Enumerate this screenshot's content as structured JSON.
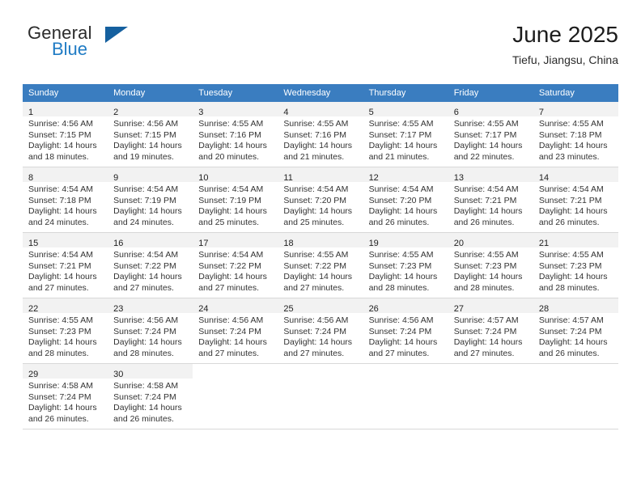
{
  "brand": {
    "line1": "General",
    "line2": "Blue",
    "triangle_icon": "triangle-logo-icon",
    "accent_color": "#1f7bc4",
    "dark_accent_color": "#15609f"
  },
  "header": {
    "title": "June 2025",
    "subtitle": "Tiefu, Jiangsu, China"
  },
  "calendar": {
    "header_bg": "#3a7dc0",
    "daynum_bg": "#f2f2f2",
    "weekdays": [
      "Sunday",
      "Monday",
      "Tuesday",
      "Wednesday",
      "Thursday",
      "Friday",
      "Saturday"
    ],
    "weeks": [
      [
        {
          "day": "1",
          "sunrise": "Sunrise: 4:56 AM",
          "sunset": "Sunset: 7:15 PM",
          "daylight1": "Daylight: 14 hours",
          "daylight2": "and 18 minutes."
        },
        {
          "day": "2",
          "sunrise": "Sunrise: 4:56 AM",
          "sunset": "Sunset: 7:15 PM",
          "daylight1": "Daylight: 14 hours",
          "daylight2": "and 19 minutes."
        },
        {
          "day": "3",
          "sunrise": "Sunrise: 4:55 AM",
          "sunset": "Sunset: 7:16 PM",
          "daylight1": "Daylight: 14 hours",
          "daylight2": "and 20 minutes."
        },
        {
          "day": "4",
          "sunrise": "Sunrise: 4:55 AM",
          "sunset": "Sunset: 7:16 PM",
          "daylight1": "Daylight: 14 hours",
          "daylight2": "and 21 minutes."
        },
        {
          "day": "5",
          "sunrise": "Sunrise: 4:55 AM",
          "sunset": "Sunset: 7:17 PM",
          "daylight1": "Daylight: 14 hours",
          "daylight2": "and 21 minutes."
        },
        {
          "day": "6",
          "sunrise": "Sunrise: 4:55 AM",
          "sunset": "Sunset: 7:17 PM",
          "daylight1": "Daylight: 14 hours",
          "daylight2": "and 22 minutes."
        },
        {
          "day": "7",
          "sunrise": "Sunrise: 4:55 AM",
          "sunset": "Sunset: 7:18 PM",
          "daylight1": "Daylight: 14 hours",
          "daylight2": "and 23 minutes."
        }
      ],
      [
        {
          "day": "8",
          "sunrise": "Sunrise: 4:54 AM",
          "sunset": "Sunset: 7:18 PM",
          "daylight1": "Daylight: 14 hours",
          "daylight2": "and 24 minutes."
        },
        {
          "day": "9",
          "sunrise": "Sunrise: 4:54 AM",
          "sunset": "Sunset: 7:19 PM",
          "daylight1": "Daylight: 14 hours",
          "daylight2": "and 24 minutes."
        },
        {
          "day": "10",
          "sunrise": "Sunrise: 4:54 AM",
          "sunset": "Sunset: 7:19 PM",
          "daylight1": "Daylight: 14 hours",
          "daylight2": "and 25 minutes."
        },
        {
          "day": "11",
          "sunrise": "Sunrise: 4:54 AM",
          "sunset": "Sunset: 7:20 PM",
          "daylight1": "Daylight: 14 hours",
          "daylight2": "and 25 minutes."
        },
        {
          "day": "12",
          "sunrise": "Sunrise: 4:54 AM",
          "sunset": "Sunset: 7:20 PM",
          "daylight1": "Daylight: 14 hours",
          "daylight2": "and 26 minutes."
        },
        {
          "day": "13",
          "sunrise": "Sunrise: 4:54 AM",
          "sunset": "Sunset: 7:21 PM",
          "daylight1": "Daylight: 14 hours",
          "daylight2": "and 26 minutes."
        },
        {
          "day": "14",
          "sunrise": "Sunrise: 4:54 AM",
          "sunset": "Sunset: 7:21 PM",
          "daylight1": "Daylight: 14 hours",
          "daylight2": "and 26 minutes."
        }
      ],
      [
        {
          "day": "15",
          "sunrise": "Sunrise: 4:54 AM",
          "sunset": "Sunset: 7:21 PM",
          "daylight1": "Daylight: 14 hours",
          "daylight2": "and 27 minutes."
        },
        {
          "day": "16",
          "sunrise": "Sunrise: 4:54 AM",
          "sunset": "Sunset: 7:22 PM",
          "daylight1": "Daylight: 14 hours",
          "daylight2": "and 27 minutes."
        },
        {
          "day": "17",
          "sunrise": "Sunrise: 4:54 AM",
          "sunset": "Sunset: 7:22 PM",
          "daylight1": "Daylight: 14 hours",
          "daylight2": "and 27 minutes."
        },
        {
          "day": "18",
          "sunrise": "Sunrise: 4:55 AM",
          "sunset": "Sunset: 7:22 PM",
          "daylight1": "Daylight: 14 hours",
          "daylight2": "and 27 minutes."
        },
        {
          "day": "19",
          "sunrise": "Sunrise: 4:55 AM",
          "sunset": "Sunset: 7:23 PM",
          "daylight1": "Daylight: 14 hours",
          "daylight2": "and 28 minutes."
        },
        {
          "day": "20",
          "sunrise": "Sunrise: 4:55 AM",
          "sunset": "Sunset: 7:23 PM",
          "daylight1": "Daylight: 14 hours",
          "daylight2": "and 28 minutes."
        },
        {
          "day": "21",
          "sunrise": "Sunrise: 4:55 AM",
          "sunset": "Sunset: 7:23 PM",
          "daylight1": "Daylight: 14 hours",
          "daylight2": "and 28 minutes."
        }
      ],
      [
        {
          "day": "22",
          "sunrise": "Sunrise: 4:55 AM",
          "sunset": "Sunset: 7:23 PM",
          "daylight1": "Daylight: 14 hours",
          "daylight2": "and 28 minutes."
        },
        {
          "day": "23",
          "sunrise": "Sunrise: 4:56 AM",
          "sunset": "Sunset: 7:24 PM",
          "daylight1": "Daylight: 14 hours",
          "daylight2": "and 28 minutes."
        },
        {
          "day": "24",
          "sunrise": "Sunrise: 4:56 AM",
          "sunset": "Sunset: 7:24 PM",
          "daylight1": "Daylight: 14 hours",
          "daylight2": "and 27 minutes."
        },
        {
          "day": "25",
          "sunrise": "Sunrise: 4:56 AM",
          "sunset": "Sunset: 7:24 PM",
          "daylight1": "Daylight: 14 hours",
          "daylight2": "and 27 minutes."
        },
        {
          "day": "26",
          "sunrise": "Sunrise: 4:56 AM",
          "sunset": "Sunset: 7:24 PM",
          "daylight1": "Daylight: 14 hours",
          "daylight2": "and 27 minutes."
        },
        {
          "day": "27",
          "sunrise": "Sunrise: 4:57 AM",
          "sunset": "Sunset: 7:24 PM",
          "daylight1": "Daylight: 14 hours",
          "daylight2": "and 27 minutes."
        },
        {
          "day": "28",
          "sunrise": "Sunrise: 4:57 AM",
          "sunset": "Sunset: 7:24 PM",
          "daylight1": "Daylight: 14 hours",
          "daylight2": "and 26 minutes."
        }
      ],
      [
        {
          "day": "29",
          "sunrise": "Sunrise: 4:58 AM",
          "sunset": "Sunset: 7:24 PM",
          "daylight1": "Daylight: 14 hours",
          "daylight2": "and 26 minutes."
        },
        {
          "day": "30",
          "sunrise": "Sunrise: 4:58 AM",
          "sunset": "Sunset: 7:24 PM",
          "daylight1": "Daylight: 14 hours",
          "daylight2": "and 26 minutes."
        },
        {
          "day": "",
          "sunrise": "",
          "sunset": "",
          "daylight1": "",
          "daylight2": ""
        },
        {
          "day": "",
          "sunrise": "",
          "sunset": "",
          "daylight1": "",
          "daylight2": ""
        },
        {
          "day": "",
          "sunrise": "",
          "sunset": "",
          "daylight1": "",
          "daylight2": ""
        },
        {
          "day": "",
          "sunrise": "",
          "sunset": "",
          "daylight1": "",
          "daylight2": ""
        },
        {
          "day": "",
          "sunrise": "",
          "sunset": "",
          "daylight1": "",
          "daylight2": ""
        }
      ]
    ]
  }
}
